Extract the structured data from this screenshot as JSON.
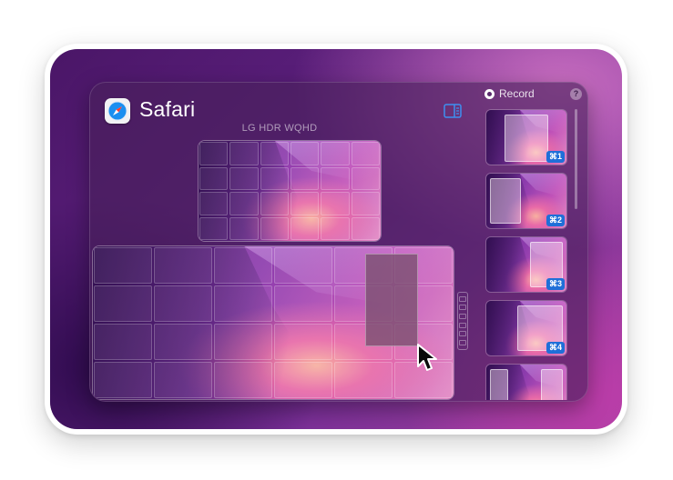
{
  "app": {
    "name": "Safari",
    "icon": "safari-compass-icon"
  },
  "display": {
    "secondary_label": "LG HDR WQHD"
  },
  "header": {
    "sidebar_toggle_icon": "sidebar-toggle-icon"
  },
  "record": {
    "label": "Record"
  },
  "help": {
    "label": "?"
  },
  "layouts": [
    {
      "shortcut": "⌘1"
    },
    {
      "shortcut": "⌘2"
    },
    {
      "shortcut": "⌘3"
    },
    {
      "shortcut": "⌘4"
    },
    {
      "shortcut": ""
    }
  ],
  "colors": {
    "accent": "#1f6fd8",
    "panel": "#48205a"
  }
}
